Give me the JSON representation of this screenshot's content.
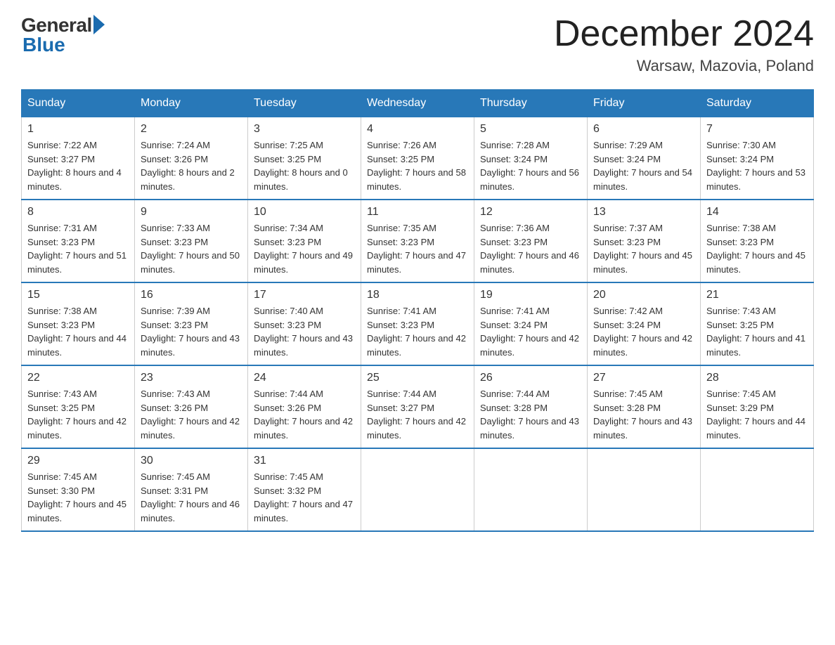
{
  "logo": {
    "general": "General",
    "blue": "Blue"
  },
  "title": "December 2024",
  "location": "Warsaw, Mazovia, Poland",
  "days_of_week": [
    "Sunday",
    "Monday",
    "Tuesday",
    "Wednesday",
    "Thursday",
    "Friday",
    "Saturday"
  ],
  "weeks": [
    [
      {
        "day": "1",
        "sunrise": "7:22 AM",
        "sunset": "3:27 PM",
        "daylight": "8 hours and 4 minutes."
      },
      {
        "day": "2",
        "sunrise": "7:24 AM",
        "sunset": "3:26 PM",
        "daylight": "8 hours and 2 minutes."
      },
      {
        "day": "3",
        "sunrise": "7:25 AM",
        "sunset": "3:25 PM",
        "daylight": "8 hours and 0 minutes."
      },
      {
        "day": "4",
        "sunrise": "7:26 AM",
        "sunset": "3:25 PM",
        "daylight": "7 hours and 58 minutes."
      },
      {
        "day": "5",
        "sunrise": "7:28 AM",
        "sunset": "3:24 PM",
        "daylight": "7 hours and 56 minutes."
      },
      {
        "day": "6",
        "sunrise": "7:29 AM",
        "sunset": "3:24 PM",
        "daylight": "7 hours and 54 minutes."
      },
      {
        "day": "7",
        "sunrise": "7:30 AM",
        "sunset": "3:24 PM",
        "daylight": "7 hours and 53 minutes."
      }
    ],
    [
      {
        "day": "8",
        "sunrise": "7:31 AM",
        "sunset": "3:23 PM",
        "daylight": "7 hours and 51 minutes."
      },
      {
        "day": "9",
        "sunrise": "7:33 AM",
        "sunset": "3:23 PM",
        "daylight": "7 hours and 50 minutes."
      },
      {
        "day": "10",
        "sunrise": "7:34 AM",
        "sunset": "3:23 PM",
        "daylight": "7 hours and 49 minutes."
      },
      {
        "day": "11",
        "sunrise": "7:35 AM",
        "sunset": "3:23 PM",
        "daylight": "7 hours and 47 minutes."
      },
      {
        "day": "12",
        "sunrise": "7:36 AM",
        "sunset": "3:23 PM",
        "daylight": "7 hours and 46 minutes."
      },
      {
        "day": "13",
        "sunrise": "7:37 AM",
        "sunset": "3:23 PM",
        "daylight": "7 hours and 45 minutes."
      },
      {
        "day": "14",
        "sunrise": "7:38 AM",
        "sunset": "3:23 PM",
        "daylight": "7 hours and 45 minutes."
      }
    ],
    [
      {
        "day": "15",
        "sunrise": "7:38 AM",
        "sunset": "3:23 PM",
        "daylight": "7 hours and 44 minutes."
      },
      {
        "day": "16",
        "sunrise": "7:39 AM",
        "sunset": "3:23 PM",
        "daylight": "7 hours and 43 minutes."
      },
      {
        "day": "17",
        "sunrise": "7:40 AM",
        "sunset": "3:23 PM",
        "daylight": "7 hours and 43 minutes."
      },
      {
        "day": "18",
        "sunrise": "7:41 AM",
        "sunset": "3:23 PM",
        "daylight": "7 hours and 42 minutes."
      },
      {
        "day": "19",
        "sunrise": "7:41 AM",
        "sunset": "3:24 PM",
        "daylight": "7 hours and 42 minutes."
      },
      {
        "day": "20",
        "sunrise": "7:42 AM",
        "sunset": "3:24 PM",
        "daylight": "7 hours and 42 minutes."
      },
      {
        "day": "21",
        "sunrise": "7:43 AM",
        "sunset": "3:25 PM",
        "daylight": "7 hours and 41 minutes."
      }
    ],
    [
      {
        "day": "22",
        "sunrise": "7:43 AM",
        "sunset": "3:25 PM",
        "daylight": "7 hours and 42 minutes."
      },
      {
        "day": "23",
        "sunrise": "7:43 AM",
        "sunset": "3:26 PM",
        "daylight": "7 hours and 42 minutes."
      },
      {
        "day": "24",
        "sunrise": "7:44 AM",
        "sunset": "3:26 PM",
        "daylight": "7 hours and 42 minutes."
      },
      {
        "day": "25",
        "sunrise": "7:44 AM",
        "sunset": "3:27 PM",
        "daylight": "7 hours and 42 minutes."
      },
      {
        "day": "26",
        "sunrise": "7:44 AM",
        "sunset": "3:28 PM",
        "daylight": "7 hours and 43 minutes."
      },
      {
        "day": "27",
        "sunrise": "7:45 AM",
        "sunset": "3:28 PM",
        "daylight": "7 hours and 43 minutes."
      },
      {
        "day": "28",
        "sunrise": "7:45 AM",
        "sunset": "3:29 PM",
        "daylight": "7 hours and 44 minutes."
      }
    ],
    [
      {
        "day": "29",
        "sunrise": "7:45 AM",
        "sunset": "3:30 PM",
        "daylight": "7 hours and 45 minutes."
      },
      {
        "day": "30",
        "sunrise": "7:45 AM",
        "sunset": "3:31 PM",
        "daylight": "7 hours and 46 minutes."
      },
      {
        "day": "31",
        "sunrise": "7:45 AM",
        "sunset": "3:32 PM",
        "daylight": "7 hours and 47 minutes."
      },
      null,
      null,
      null,
      null
    ]
  ]
}
